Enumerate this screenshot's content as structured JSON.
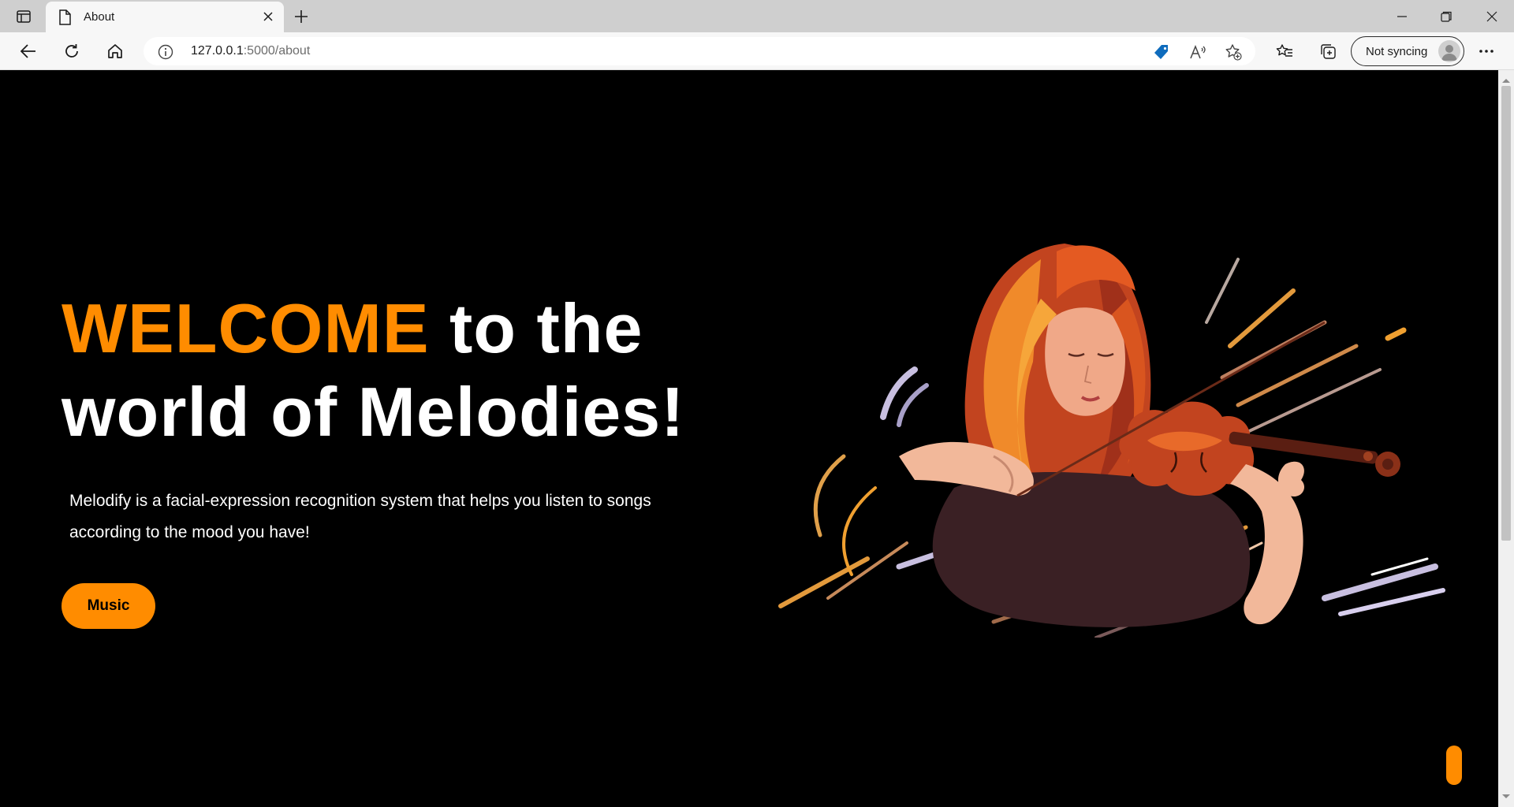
{
  "browser": {
    "tab_title": "About",
    "url_host": "127.0.0.1",
    "url_rest": ":5000/about",
    "sync_label": "Not syncing"
  },
  "page": {
    "headline_accent": "WELCOME",
    "headline_line1_rest": " to the",
    "headline_line2": "world of Melodies!",
    "description": "Melodify is a facial-expression recognition system that helps you listen to songs according to the mood you have!",
    "music_button": "Music"
  },
  "colors": {
    "accent": "#ff8c00",
    "background": "#000000",
    "text": "#ffffff"
  },
  "icons": [
    "tab-actions-icon",
    "document-icon",
    "close-icon",
    "plus-icon",
    "minimize-icon",
    "restore-icon",
    "window-close-icon",
    "back-icon",
    "refresh-icon",
    "home-icon",
    "info-icon",
    "shopping-tag-icon",
    "read-aloud-icon",
    "add-favorite-icon",
    "favorites-icon",
    "collections-icon",
    "profile-icon",
    "more-icon"
  ]
}
